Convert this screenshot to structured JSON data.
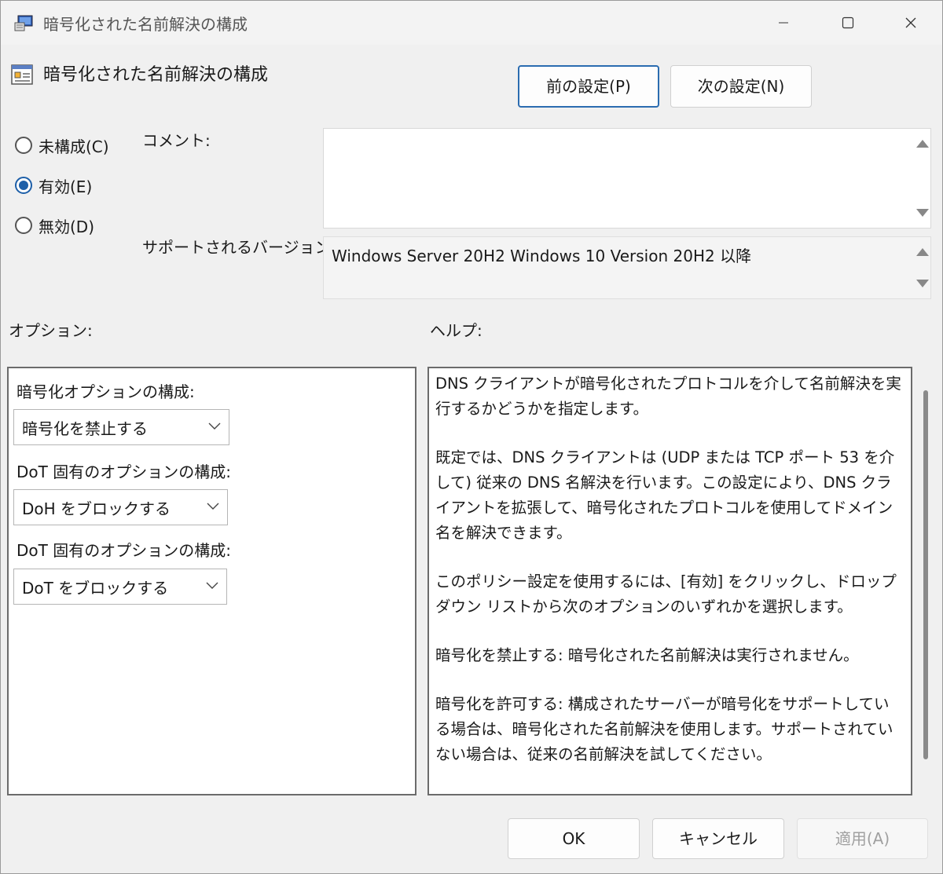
{
  "window": {
    "title": "暗号化された名前解決の構成",
    "controls": {
      "minimize": "–",
      "maximize": "☐",
      "close": "✕"
    }
  },
  "header": {
    "title": "暗号化された名前解決の構成",
    "prev_button": "前の設定(P)",
    "next_button": "次の設定(N)"
  },
  "state": {
    "options": [
      {
        "label": "未構成(C)",
        "checked": false
      },
      {
        "label": "有効(E)",
        "checked": true
      },
      {
        "label": "無効(D)",
        "checked": false
      }
    ]
  },
  "comment": {
    "label": "コメント:",
    "value": ""
  },
  "supported": {
    "label": "サポートされるバージョン:",
    "value": "Windows Server 20H2 Windows 10 Version 20H2 以降"
  },
  "options_section": {
    "label": "オプション:",
    "fields": [
      {
        "label": "暗号化オプションの構成:",
        "value": "暗号化を禁止する"
      },
      {
        "label": "DoT 固有のオプションの構成:",
        "value": "DoH をブロックする"
      },
      {
        "label": "DoT 固有のオプションの構成:",
        "value": "DoT をブロックする"
      }
    ]
  },
  "help_section": {
    "label": "ヘルプ:",
    "paragraphs": [
      "DNS クライアントが暗号化されたプロトコルを介して名前解決を実行するかどうかを指定します。",
      "既定では、DNS クライアントは (UDP または TCP ポート 53 を介して) 従来の DNS 名解決を行います。この設定により、DNS クライアントを拡張して、暗号化されたプロトコルを使用してドメイン名を解決できます。",
      "このポリシー設定を使用するには、[有効] をクリックし、ドロップダウン リストから次のオプションのいずれかを選択します。",
      "暗号化を禁止する: 暗号化された名前解決は実行されません。",
      "暗号化を許可する: 構成されたサーバーが暗号化をサポートしている場合は、暗号化された名前解決を使用します。サポートされていない場合は、従来の名前解決を試してください。"
    ]
  },
  "footer": {
    "ok": "OK",
    "cancel": "キャンセル",
    "apply": "適用(A)"
  }
}
